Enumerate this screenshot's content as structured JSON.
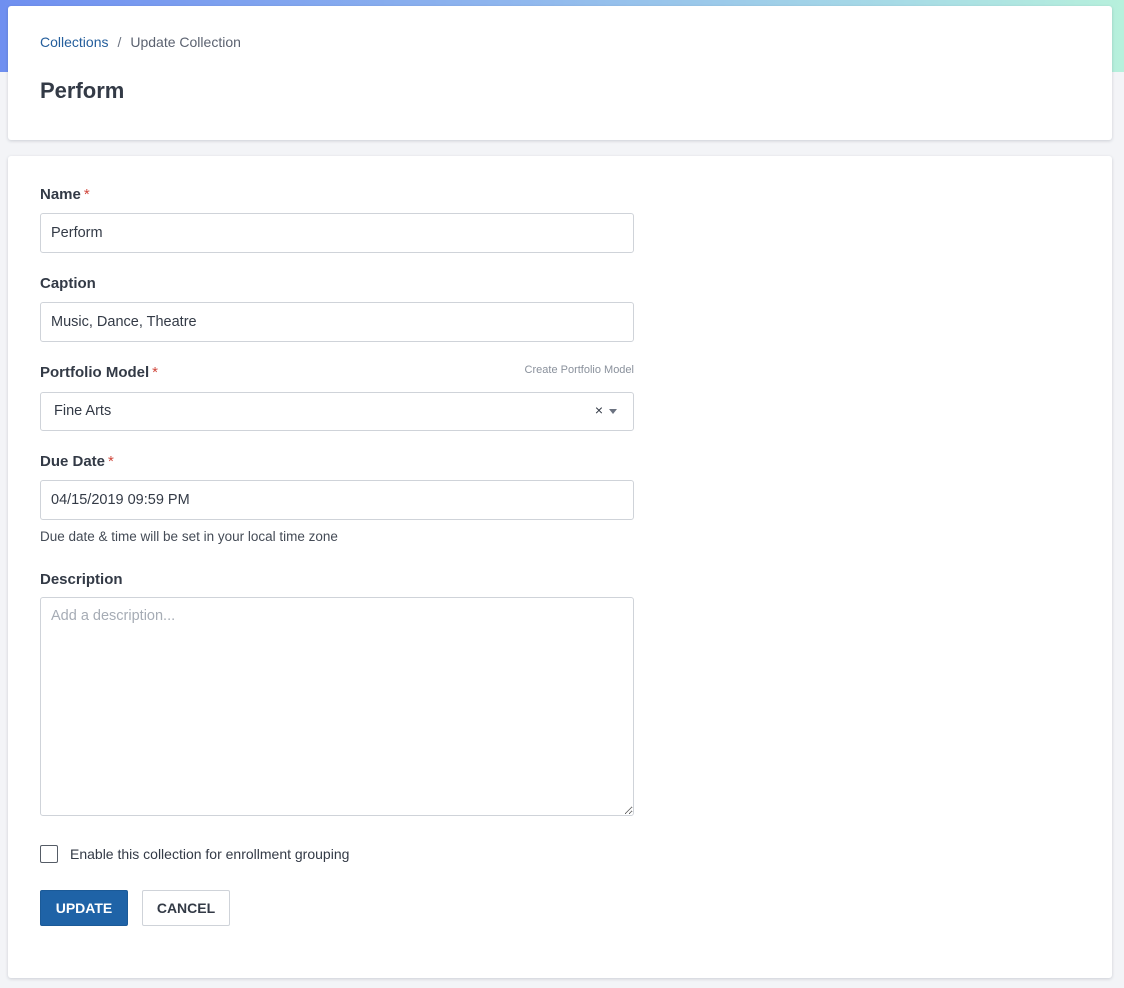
{
  "breadcrumb": {
    "link": "Collections",
    "separator": "/",
    "current": "Update Collection"
  },
  "page": {
    "title": "Perform"
  },
  "form": {
    "name": {
      "label": "Name",
      "required_mark": "*",
      "value": "Perform"
    },
    "caption": {
      "label": "Caption",
      "value": "Music, Dance, Theatre"
    },
    "portfolio_model": {
      "label": "Portfolio Model",
      "required_mark": "*",
      "create_link": "Create Portfolio Model",
      "selected": "Fine Arts",
      "clear_glyph": "×"
    },
    "due_date": {
      "label": "Due Date",
      "required_mark": "*",
      "value": "04/15/2019 09:59 PM",
      "help": "Due date & time will be set in your local time zone"
    },
    "description": {
      "label": "Description",
      "placeholder": "Add a description..."
    },
    "enrollment": {
      "label": "Enable this collection for enrollment grouping",
      "checked": false
    },
    "buttons": {
      "update": "UPDATE",
      "cancel": "CANCEL"
    }
  },
  "colors": {
    "primary": "#1f63a7",
    "link": "#245e9c",
    "required": "#d0463b",
    "text": "#333a46"
  },
  "icons": {
    "clear": "close-icon",
    "dropdown": "caret-down-icon",
    "textarea_resize": "resize-grip-icon"
  }
}
